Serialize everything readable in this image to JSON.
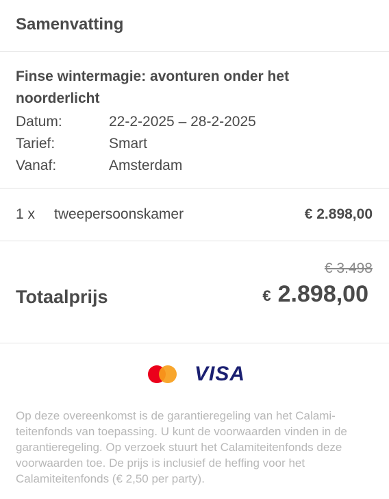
{
  "header": {
    "title": "Samenvatting"
  },
  "trip": {
    "title": "Finse wintermagie: avonturen onder het noorderlicht",
    "details": [
      {
        "label": "Datum:",
        "value": "22-2-2025 – 28-2-2025"
      },
      {
        "label": "Tarief:",
        "value": "Smart"
      },
      {
        "label": "Vanaf:",
        "value": "Amsterdam"
      }
    ]
  },
  "line_item": {
    "qty": "1 x",
    "name": "tweepersoonskamer",
    "amount": "€ 2.898,00"
  },
  "total": {
    "label": "Totaalprijs",
    "old_price": "€ 3.498",
    "currency": "€",
    "price": "2.898,00"
  },
  "payment": {
    "visa_label": "VISA",
    "mastercard_icon": "mastercard-icon"
  },
  "note": "Op deze overeenkomst is de garantieregeling van het Calami-teitenfonds van toepassing. U kunt de voorwaarden vinden in de garantieregeling. Op verzoek stuurt het Calamiteitenfonds deze voorwaarden toe. De prijs is inclusief de heffing voor het Calamiteitenfonds (€ 2,50 per party)."
}
